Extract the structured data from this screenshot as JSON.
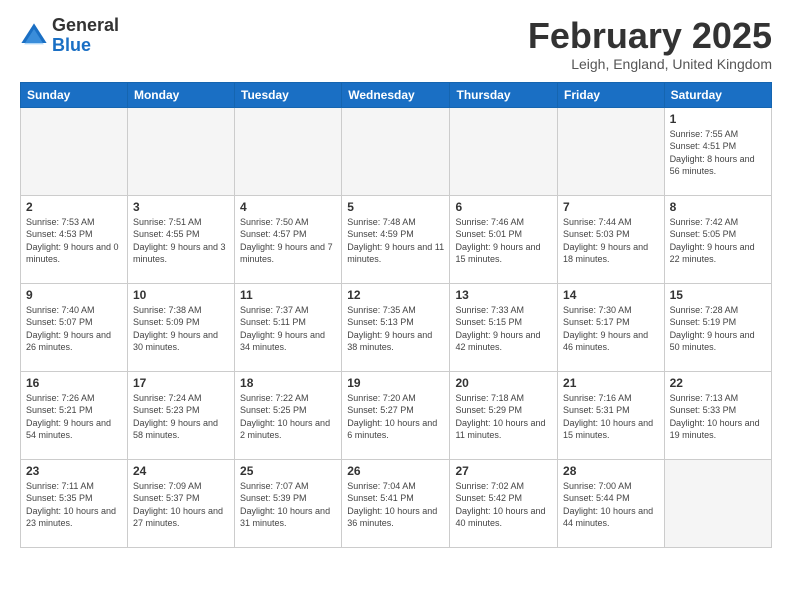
{
  "logo": {
    "general": "General",
    "blue": "Blue"
  },
  "title": "February 2025",
  "location": "Leigh, England, United Kingdom",
  "weekdays": [
    "Sunday",
    "Monday",
    "Tuesday",
    "Wednesday",
    "Thursday",
    "Friday",
    "Saturday"
  ],
  "weeks": [
    [
      {
        "day": "",
        "info": ""
      },
      {
        "day": "",
        "info": ""
      },
      {
        "day": "",
        "info": ""
      },
      {
        "day": "",
        "info": ""
      },
      {
        "day": "",
        "info": ""
      },
      {
        "day": "",
        "info": ""
      },
      {
        "day": "1",
        "info": "Sunrise: 7:55 AM\nSunset: 4:51 PM\nDaylight: 8 hours and 56 minutes."
      }
    ],
    [
      {
        "day": "2",
        "info": "Sunrise: 7:53 AM\nSunset: 4:53 PM\nDaylight: 9 hours and 0 minutes."
      },
      {
        "day": "3",
        "info": "Sunrise: 7:51 AM\nSunset: 4:55 PM\nDaylight: 9 hours and 3 minutes."
      },
      {
        "day": "4",
        "info": "Sunrise: 7:50 AM\nSunset: 4:57 PM\nDaylight: 9 hours and 7 minutes."
      },
      {
        "day": "5",
        "info": "Sunrise: 7:48 AM\nSunset: 4:59 PM\nDaylight: 9 hours and 11 minutes."
      },
      {
        "day": "6",
        "info": "Sunrise: 7:46 AM\nSunset: 5:01 PM\nDaylight: 9 hours and 15 minutes."
      },
      {
        "day": "7",
        "info": "Sunrise: 7:44 AM\nSunset: 5:03 PM\nDaylight: 9 hours and 18 minutes."
      },
      {
        "day": "8",
        "info": "Sunrise: 7:42 AM\nSunset: 5:05 PM\nDaylight: 9 hours and 22 minutes."
      }
    ],
    [
      {
        "day": "9",
        "info": "Sunrise: 7:40 AM\nSunset: 5:07 PM\nDaylight: 9 hours and 26 minutes."
      },
      {
        "day": "10",
        "info": "Sunrise: 7:38 AM\nSunset: 5:09 PM\nDaylight: 9 hours and 30 minutes."
      },
      {
        "day": "11",
        "info": "Sunrise: 7:37 AM\nSunset: 5:11 PM\nDaylight: 9 hours and 34 minutes."
      },
      {
        "day": "12",
        "info": "Sunrise: 7:35 AM\nSunset: 5:13 PM\nDaylight: 9 hours and 38 minutes."
      },
      {
        "day": "13",
        "info": "Sunrise: 7:33 AM\nSunset: 5:15 PM\nDaylight: 9 hours and 42 minutes."
      },
      {
        "day": "14",
        "info": "Sunrise: 7:30 AM\nSunset: 5:17 PM\nDaylight: 9 hours and 46 minutes."
      },
      {
        "day": "15",
        "info": "Sunrise: 7:28 AM\nSunset: 5:19 PM\nDaylight: 9 hours and 50 minutes."
      }
    ],
    [
      {
        "day": "16",
        "info": "Sunrise: 7:26 AM\nSunset: 5:21 PM\nDaylight: 9 hours and 54 minutes."
      },
      {
        "day": "17",
        "info": "Sunrise: 7:24 AM\nSunset: 5:23 PM\nDaylight: 9 hours and 58 minutes."
      },
      {
        "day": "18",
        "info": "Sunrise: 7:22 AM\nSunset: 5:25 PM\nDaylight: 10 hours and 2 minutes."
      },
      {
        "day": "19",
        "info": "Sunrise: 7:20 AM\nSunset: 5:27 PM\nDaylight: 10 hours and 6 minutes."
      },
      {
        "day": "20",
        "info": "Sunrise: 7:18 AM\nSunset: 5:29 PM\nDaylight: 10 hours and 11 minutes."
      },
      {
        "day": "21",
        "info": "Sunrise: 7:16 AM\nSunset: 5:31 PM\nDaylight: 10 hours and 15 minutes."
      },
      {
        "day": "22",
        "info": "Sunrise: 7:13 AM\nSunset: 5:33 PM\nDaylight: 10 hours and 19 minutes."
      }
    ],
    [
      {
        "day": "23",
        "info": "Sunrise: 7:11 AM\nSunset: 5:35 PM\nDaylight: 10 hours and 23 minutes."
      },
      {
        "day": "24",
        "info": "Sunrise: 7:09 AM\nSunset: 5:37 PM\nDaylight: 10 hours and 27 minutes."
      },
      {
        "day": "25",
        "info": "Sunrise: 7:07 AM\nSunset: 5:39 PM\nDaylight: 10 hours and 31 minutes."
      },
      {
        "day": "26",
        "info": "Sunrise: 7:04 AM\nSunset: 5:41 PM\nDaylight: 10 hours and 36 minutes."
      },
      {
        "day": "27",
        "info": "Sunrise: 7:02 AM\nSunset: 5:42 PM\nDaylight: 10 hours and 40 minutes."
      },
      {
        "day": "28",
        "info": "Sunrise: 7:00 AM\nSunset: 5:44 PM\nDaylight: 10 hours and 44 minutes."
      },
      {
        "day": "",
        "info": ""
      }
    ]
  ]
}
